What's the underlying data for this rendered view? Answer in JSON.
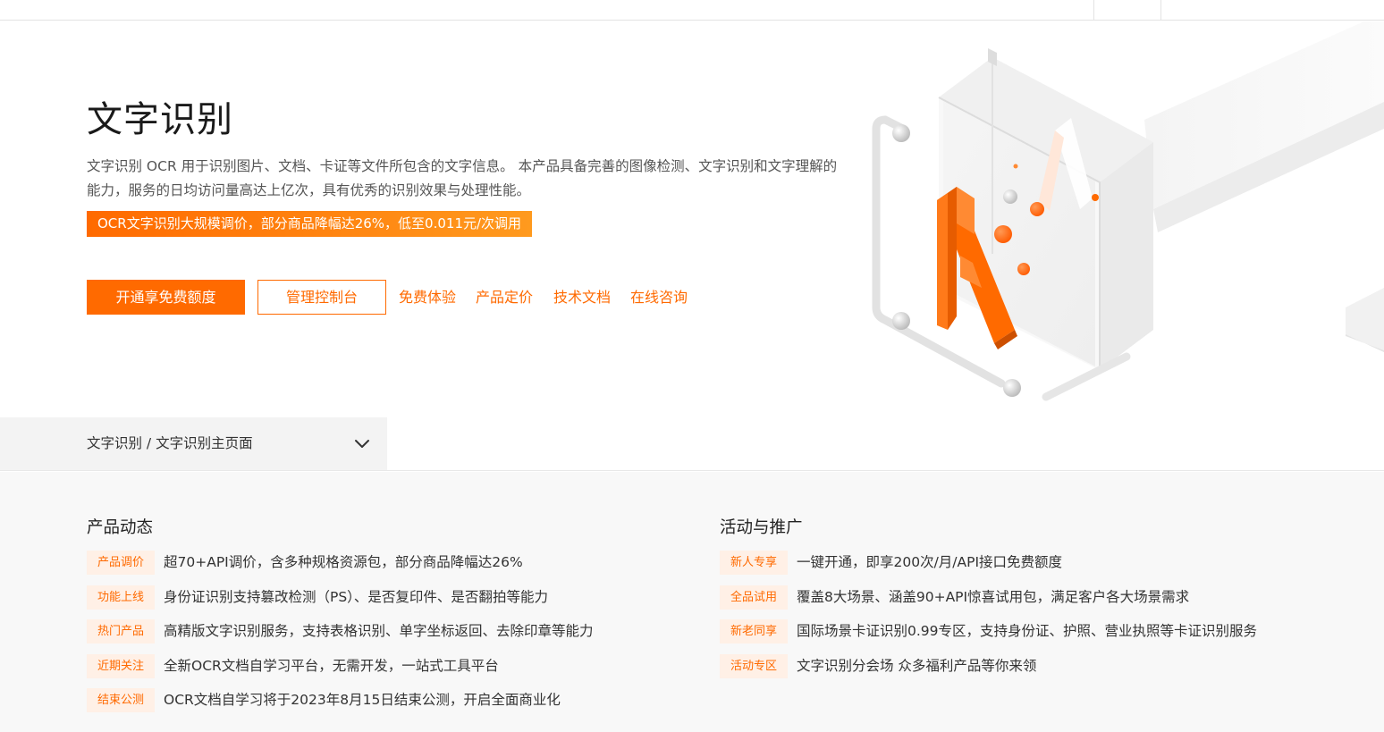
{
  "hero": {
    "title": "文字识别",
    "description": "文字识别 OCR 用于识别图片、文档、卡证等文件所包含的文字信息。 本产品具备完善的图像检测、文字识别和文字理解的能力，服务的日均访问量高达上亿次，具有优秀的识别效果与处理性能。",
    "promo": "OCR文字识别大规模调价，部分商品降幅达26%，低至0.011元/次调用",
    "primary_button": "开通享免费额度",
    "secondary_button": "管理控制台",
    "links": [
      "免费体验",
      "产品定价",
      "技术文档",
      "在线咨询"
    ],
    "accent_color": "#ff6a00"
  },
  "breadcrumb": {
    "text": "文字识别 / 文字识别主页面",
    "icon": "chevron-down-icon"
  },
  "product_news": {
    "title": "产品动态",
    "items": [
      {
        "tag": "产品调价",
        "text": "超70+API调价，含多种规格资源包，部分商品降幅达26%"
      },
      {
        "tag": "功能上线",
        "text": "身份证识别支持篡改检测（PS）、是否复印件、是否翻拍等能力"
      },
      {
        "tag": "热门产品",
        "text": "高精版文字识别服务，支持表格识别、单字坐标返回、去除印章等能力"
      },
      {
        "tag": "近期关注",
        "text": "全新OCR文档自学习平台，无需开发，一站式工具平台"
      },
      {
        "tag": "结束公测",
        "text": "OCR文档自学习将于2023年8月15日结束公测，开启全面商业化"
      }
    ]
  },
  "promotions": {
    "title": "活动与推广",
    "items": [
      {
        "tag": "新人专享",
        "text": "一键开通，即享200次/月/API接口免费额度"
      },
      {
        "tag": "全品试用",
        "text": "覆盖8大场景、涵盖90+API惊喜试用包，满足客户各大场景需求"
      },
      {
        "tag": "新老同享",
        "text": "国际场景卡证识别0.99专区，支持身份证、护照、营业执照等卡证识别服务"
      },
      {
        "tag": "活动专区",
        "text": "文字识别分会场 众多福利产品等你来领"
      }
    ]
  }
}
